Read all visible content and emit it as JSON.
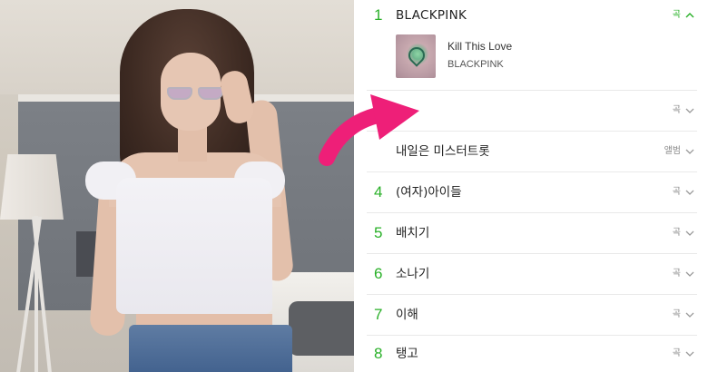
{
  "colors": {
    "rank_green": "#29b028",
    "arrow_pink": "#ee1f78",
    "divider": "#e9e9e9"
  },
  "chart_list": {
    "rows": [
      {
        "rank": "1",
        "title": "BLACKPINK",
        "type": "곡",
        "icon": "chevron-up-icon",
        "expanded_item": {
          "song": "Kill This Love",
          "artist": "BLACKPINK"
        }
      },
      {
        "rank": "",
        "title": "",
        "type": "곡",
        "icon": "chevron-down-icon"
      },
      {
        "rank": "",
        "title": "내일은 미스터트롯",
        "type": "앨범",
        "icon": "chevron-down-icon"
      },
      {
        "rank": "4",
        "title": "(여자)아이들",
        "type": "곡",
        "icon": "chevron-down-icon"
      },
      {
        "rank": "5",
        "title": "배치기",
        "type": "곡",
        "icon": "chevron-down-icon"
      },
      {
        "rank": "6",
        "title": "소나기",
        "type": "곡",
        "icon": "chevron-down-icon"
      },
      {
        "rank": "7",
        "title": "이해",
        "type": "곡",
        "icon": "chevron-down-icon"
      },
      {
        "rank": "8",
        "title": "탱고",
        "type": "곡",
        "icon": "chevron-down-icon"
      }
    ]
  }
}
